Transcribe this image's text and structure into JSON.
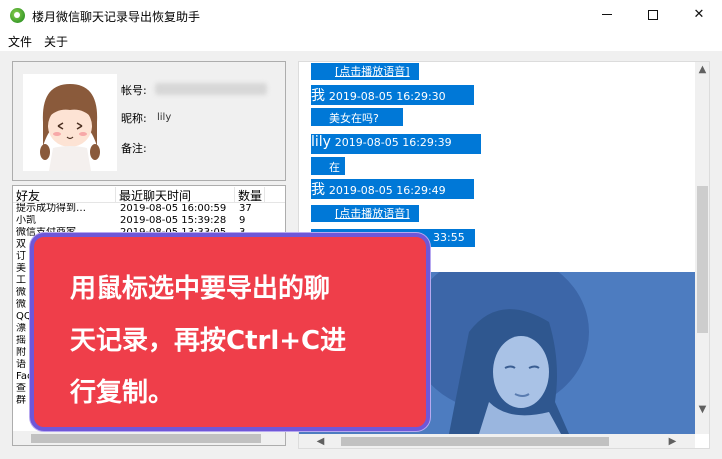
{
  "window": {
    "title": "楼月微信聊天记录导出恢复助手",
    "icon": "app-icon"
  },
  "menu": {
    "items": [
      "文件",
      "关于"
    ]
  },
  "profile": {
    "account_label": "帐号:",
    "nickname_label": "昵称:",
    "nickname_value": "lily",
    "remark_label": "备注:"
  },
  "contact_list": {
    "headers": {
      "name": "好友",
      "time": "最近聊天时间",
      "count": "数量"
    },
    "rows": [
      {
        "name": "提示成功得到…",
        "time": "2019-08-05 16:00:59",
        "count": "37"
      },
      {
        "name": "小凯",
        "time": "2019-08-05 15:39:28",
        "count": "9"
      },
      {
        "name": "微信支付商家",
        "time": "2019-08-05 13:33:05",
        "count": "3"
      },
      {
        "name": "双",
        "time": "",
        "count": ""
      },
      {
        "name": "订",
        "time": "",
        "count": ""
      },
      {
        "name": "美",
        "time": "",
        "count": ""
      },
      {
        "name": "工",
        "time": "",
        "count": ""
      },
      {
        "name": "微",
        "time": "",
        "count": ""
      },
      {
        "name": "微",
        "time": "",
        "count": ""
      },
      {
        "name": "QQ",
        "time": "",
        "count": ""
      },
      {
        "name": "漂",
        "time": "",
        "count": ""
      },
      {
        "name": "摇",
        "time": "",
        "count": ""
      },
      {
        "name": "附",
        "time": "",
        "count": ""
      },
      {
        "name": "语",
        "time": "",
        "count": ""
      },
      {
        "name": "Fac",
        "time": "",
        "count": ""
      },
      {
        "name": "查",
        "time": "",
        "count": ""
      },
      {
        "name": "群",
        "time": "",
        "count": ""
      }
    ]
  },
  "chat": {
    "lines": [
      {
        "kind": "link",
        "text": "[点击播放语音]"
      },
      {
        "kind": "header",
        "sender": "我",
        "time": "2019-08-05 16:29:30"
      },
      {
        "kind": "text",
        "text": "美女在吗?"
      },
      {
        "kind": "header",
        "sender": "lily",
        "time": "2019-08-05 16:29:39"
      },
      {
        "kind": "text",
        "text": "在"
      },
      {
        "kind": "header",
        "sender": "我",
        "time": "2019-08-05 16:29:49"
      },
      {
        "kind": "link",
        "text": "[点击播放语音]"
      },
      {
        "kind": "partial",
        "text": "33:55"
      }
    ],
    "selection_color": "#0078d7"
  },
  "callout": {
    "lines": [
      "用鼠标选中要导出的聊",
      "天记录，再按Ctrl+C进",
      "行复制。"
    ],
    "background": "#ef3e4a",
    "border": "#6f57d8"
  }
}
